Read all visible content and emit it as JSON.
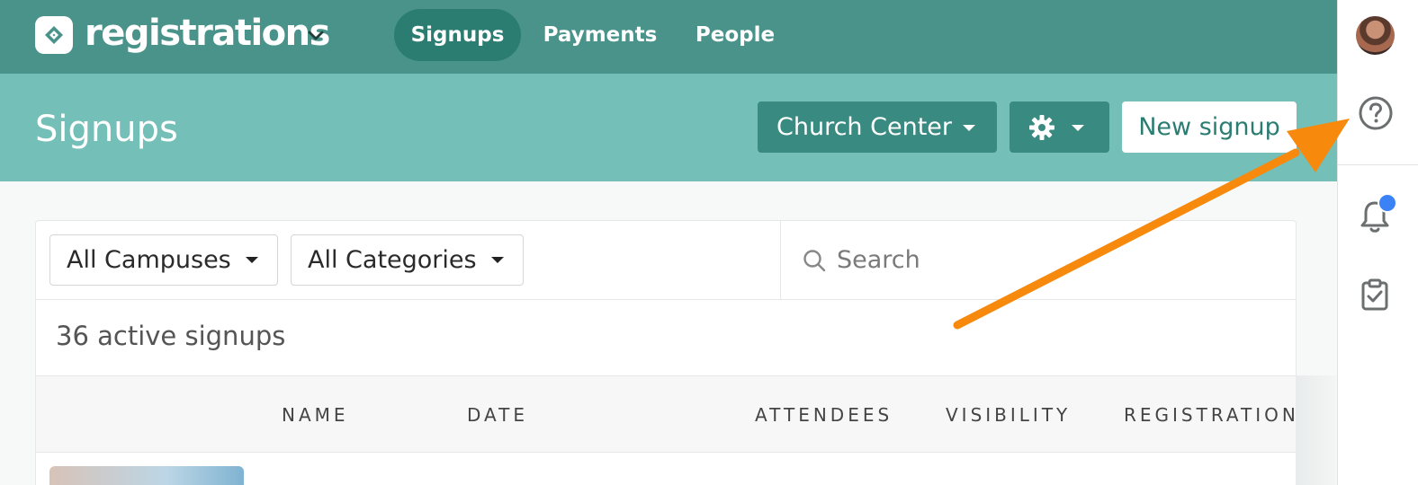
{
  "topbar": {
    "app_title": "registrations",
    "tabs": [
      {
        "label": "Signups",
        "active": true
      },
      {
        "label": "Payments",
        "active": false
      },
      {
        "label": "People",
        "active": false
      }
    ]
  },
  "header": {
    "title": "Signups",
    "church_center_label": "Church Center",
    "new_signup_label": "New signup"
  },
  "filters": {
    "campus_select": "All Campuses",
    "category_select": "All Categories",
    "search_placeholder": "Search"
  },
  "summary": {
    "count_text": "36 active signups"
  },
  "table": {
    "columns": [
      "NAME",
      "DATE",
      "ATTENDEES",
      "VISIBILITY",
      "REGISTRATION"
    ]
  },
  "rail": {
    "icons": [
      "avatar",
      "help-icon",
      "bell-icon",
      "clipboard-check-icon"
    ],
    "notification_dot": true
  },
  "colors": {
    "nav_bg": "#49938a",
    "nav_active": "#2b7d72",
    "header_bg": "#74bfb7",
    "button_dark": "#398a80",
    "annotation_arrow": "#f7890c",
    "notification": "#3b82f6"
  }
}
